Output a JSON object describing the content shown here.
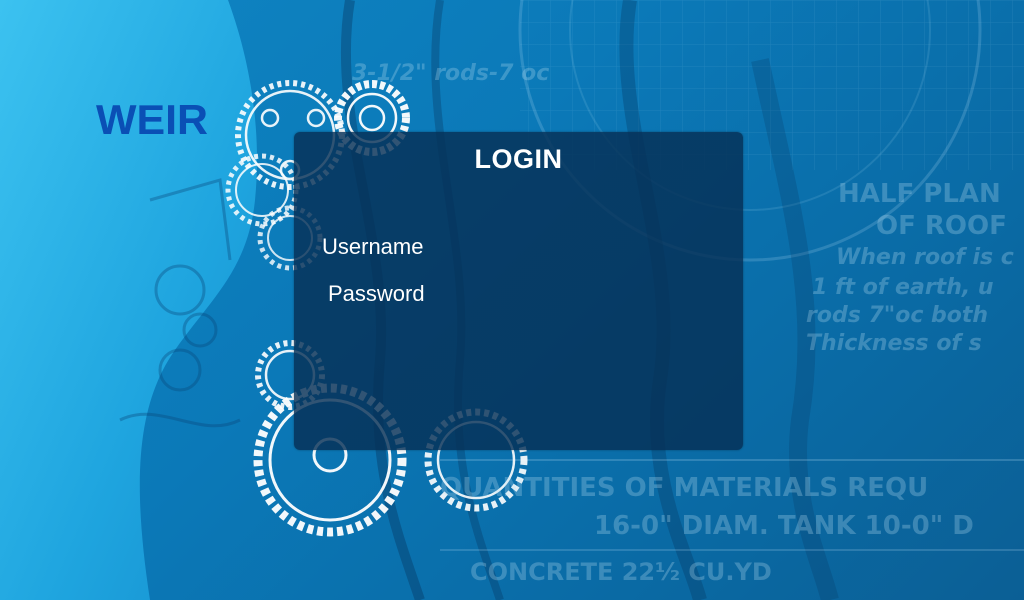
{
  "brand": {
    "logo_text": "WEIR",
    "logo_color": "#0a4fb5"
  },
  "login": {
    "title": "LOGIN",
    "username_label": "Username",
    "password_label": "Password",
    "username_value": "",
    "password_value": "",
    "panel_color": "#063056"
  },
  "background": {
    "blueprint_lines": [
      "3-1/2\" rods-7 oc",
      "HALF PLAN",
      "OF ROOF",
      "When roof is c",
      "1 ft of earth, u",
      "rods 7\"oc both",
      "Thickness of s",
      "QUANTITIES OF MATERIALS REQU",
      "16-0\" DIAM. TANK 10-0\" D",
      "CONCRETE 22½ CU.YD"
    ],
    "primary_color": "#0b79b8",
    "light_color": "#31b4e8"
  }
}
